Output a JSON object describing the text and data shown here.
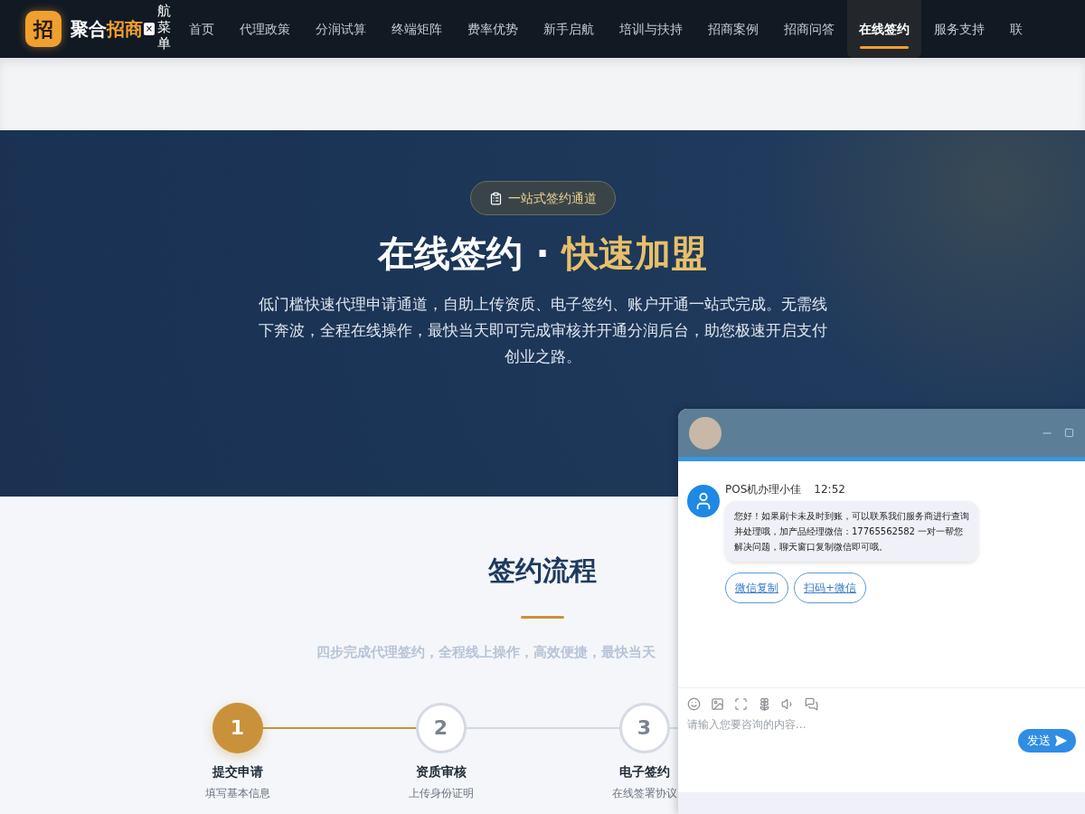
{
  "header": {
    "logo_mark": "招",
    "brand_prefix": "聚合",
    "brand_highlight": "招商",
    "close_label": "×",
    "menu_toggle": "航菜单",
    "nav": [
      {
        "label": "首页",
        "selected": false
      },
      {
        "label": "代理政策",
        "selected": false
      },
      {
        "label": "分润试算",
        "selected": false
      },
      {
        "label": "终端矩阵",
        "selected": false
      },
      {
        "label": "费率优势",
        "selected": false
      },
      {
        "label": "新手启航",
        "selected": false
      },
      {
        "label": "培训与扶持",
        "selected": false
      },
      {
        "label": "招商案例",
        "selected": false
      },
      {
        "label": "招商问答",
        "selected": false
      },
      {
        "label": "在线签约",
        "selected": true
      },
      {
        "label": "服务支持",
        "selected": false
      },
      {
        "label": "联",
        "selected": false
      }
    ]
  },
  "hero": {
    "badge": "一站式签约通道",
    "title_main": "在线签约",
    "title_separator": "·",
    "title_highlight": "快速加盟",
    "description": "低门槛快速代理申请通道，自助上传资质、电子签约、账户开通一站式完成。无需线下奔波，全程在线操作，最快当天即可完成审核并开通分润后台，助您极速开启支付创业之路。"
  },
  "process": {
    "title": "签约流程",
    "subtitle": "四步完成代理签约，全程线上操作，高效便捷，最快当天",
    "steps": [
      {
        "number": "1",
        "title": "提交申请",
        "caption": "填写基本信息",
        "completed": true
      },
      {
        "number": "2",
        "title": "资质审核",
        "caption": "上传身份证明",
        "completed": false
      },
      {
        "number": "3",
        "title": "电子签约",
        "caption": "在线签署协议",
        "completed": false
      }
    ]
  },
  "chat": {
    "messages": [
      {
        "sender": "POS机办理小佳",
        "time": "12:52",
        "text": "您好！如果刷卡未及时到账，可以联系我们服务商进行查询并处理哦，加产品经理微信：17765562582 一对一帮您解决问题，聊天窗口复制微信即可哦。",
        "actions": [
          "微信复制",
          "扫码+微信"
        ]
      }
    ],
    "input": {
      "placeholder": "请输入您要咨询的内容..."
    },
    "send_label": "发送"
  }
}
